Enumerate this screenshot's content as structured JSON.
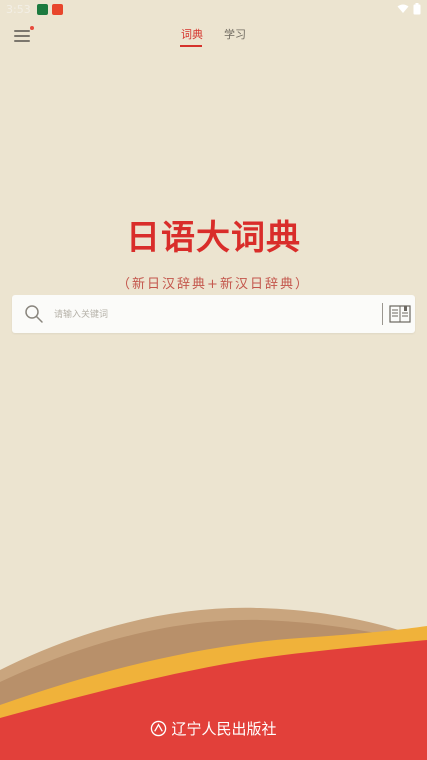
{
  "status_bar": {
    "time": "3:53",
    "app_icon_colors": [
      "#1d7a3f",
      "#e8452b"
    ],
    "wifi_icon": "wifi-icon",
    "battery_icon": "battery-icon"
  },
  "header": {
    "menu_badge_color": "#e74a3b",
    "tabs": [
      {
        "label": "词典",
        "active": true
      },
      {
        "label": "学习",
        "active": false
      }
    ]
  },
  "main": {
    "title": "日语大词典",
    "subtitle": "（新日汉辞典+新汉日辞典）"
  },
  "search": {
    "placeholder": "请输入关键词"
  },
  "footer": {
    "publisher": "辽宁人民出版社"
  },
  "colors": {
    "background": "#ece4d0",
    "accent_red": "#d92d2a",
    "wave_tan": "#b8906a",
    "wave_gold": "#f0b23a",
    "wave_red": "#e2403a"
  }
}
